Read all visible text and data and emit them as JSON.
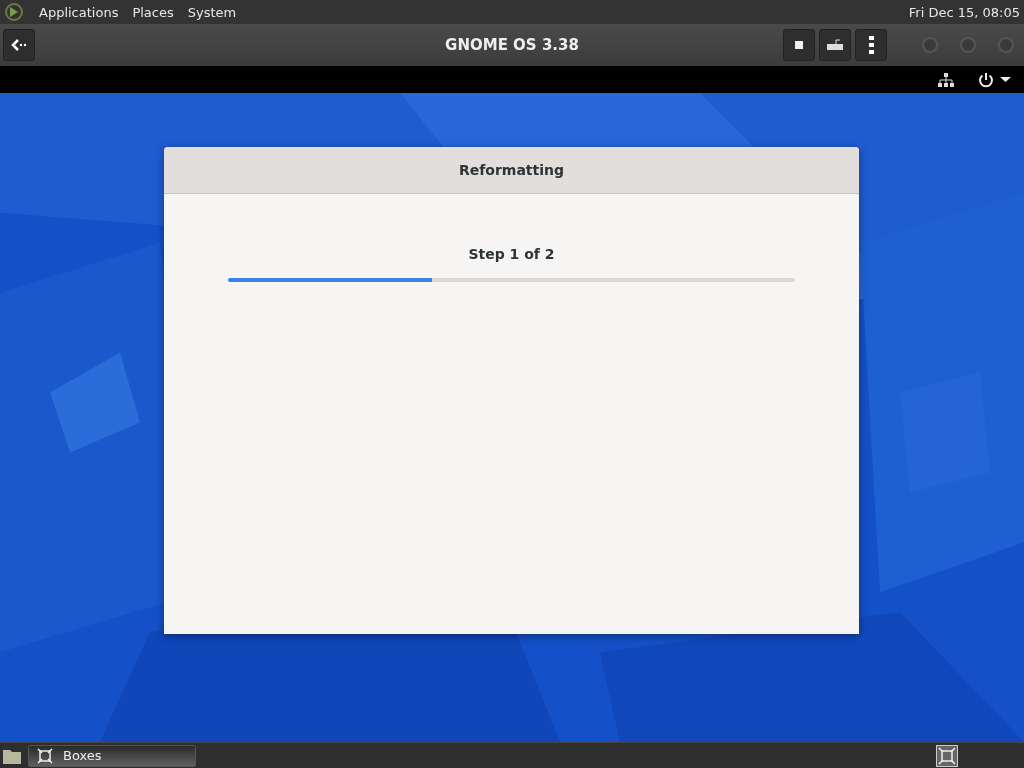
{
  "top_panel": {
    "menus": [
      {
        "label": "Applications"
      },
      {
        "label": "Places"
      },
      {
        "label": "System"
      }
    ],
    "clock": "Fri Dec 15, 08:05"
  },
  "header_bar": {
    "title": "GNOME OS 3.38"
  },
  "dialog": {
    "title": "Reformatting",
    "step": "Step 1 of 2",
    "progress": {
      "level": 0.36
    }
  },
  "taskbar": {
    "windows": [
      {
        "label": "Boxes",
        "selected": true
      }
    ]
  }
}
